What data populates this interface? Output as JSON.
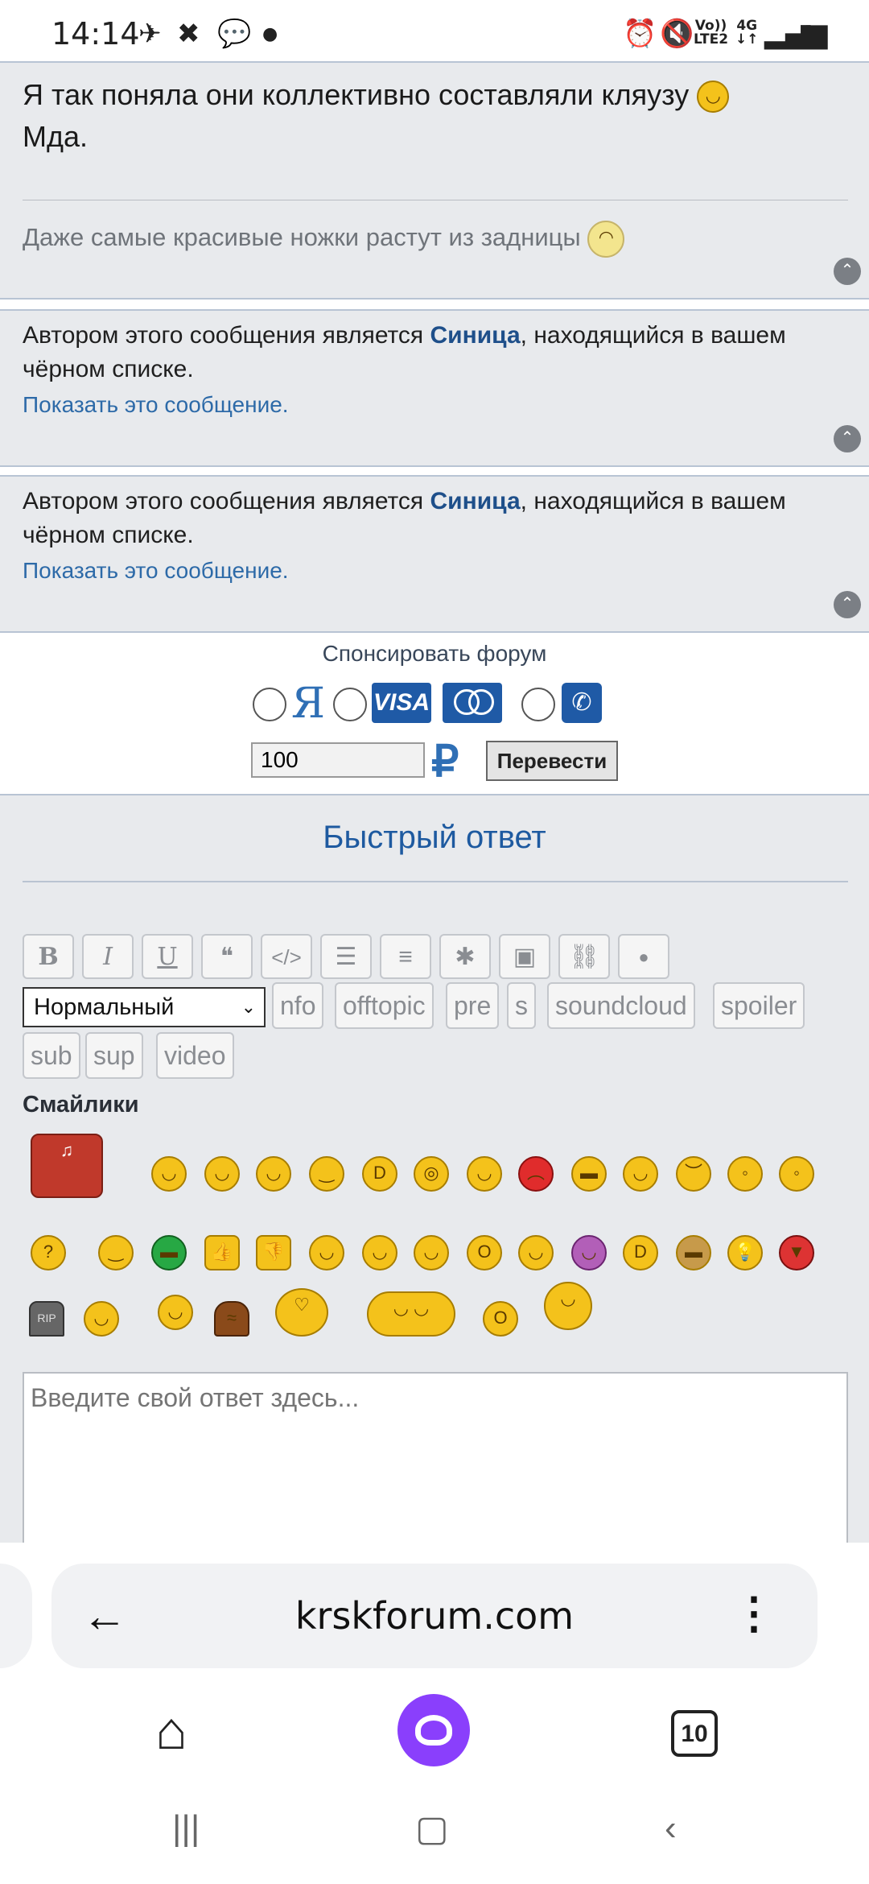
{
  "status_bar": {
    "time": "14:14",
    "network_top": "Vo))",
    "network_bottom": "LTE2",
    "gen": "4G"
  },
  "post1": {
    "message": "Я так поняла они коллективно составляли кляузу",
    "message2": "Мда.",
    "signature": "Даже самые красивые ножки растут из задницы"
  },
  "blocked_posts": [
    {
      "prefix": "Автором этого сообщения является ",
      "author": "Синица",
      "suffix": ", находящийся в вашем чёрном списке.",
      "link": "Показать это сообщение."
    },
    {
      "prefix": "Автором этого сообщения является ",
      "author": "Синица",
      "suffix": ", находящийся в вашем чёрном списке.",
      "link": "Показать это сообщение."
    }
  ],
  "sponsor": {
    "title": "Спонсировать форум",
    "ya_label": "Я",
    "visa_label": "VISA",
    "amount": "100",
    "currency": "₽",
    "button": "Перевести"
  },
  "quick_reply": {
    "title": "Быстрый ответ",
    "toolbar": [
      "B",
      "I",
      "U",
      "❝",
      "</>",
      "☰",
      "≡",
      "✱",
      "▣",
      "⛓",
      "●"
    ],
    "font_select": "Нормальный",
    "tags_row1": [
      "nfo",
      "offtopic",
      "pre",
      "s",
      "soundcloud",
      "spoiler"
    ],
    "tags_row2": [
      "sub",
      "sup",
      "video"
    ],
    "smilies_title": "Смайлики",
    "placeholder": "Введите свой ответ здесь..."
  },
  "browser": {
    "url": "krskforum.com",
    "tab_count": "10"
  }
}
